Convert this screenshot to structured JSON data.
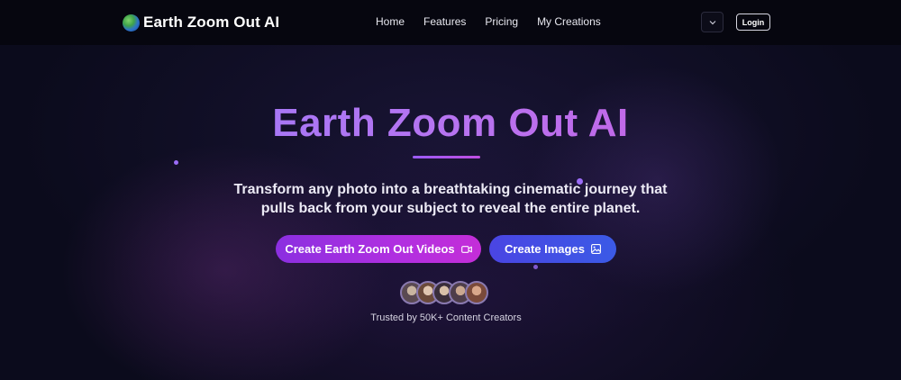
{
  "header": {
    "brand_name": "Earth Zoom Out AI",
    "brand_icon": "globe-icon",
    "nav": [
      "Home",
      "Features",
      "Pricing",
      "My Creations"
    ],
    "lang_icon": "chevron-down-icon",
    "login_label": "Login"
  },
  "hero": {
    "title": "Earth Zoom Out AI",
    "subtitle_line1": "Transform any photo into a breathtaking cinematic journey that",
    "subtitle_line2": "pulls back from your subject to reveal the entire planet.",
    "primary_button": {
      "label": "Create Earth Zoom Out Videos",
      "icon": "video-camera-icon"
    },
    "secondary_button": {
      "label": "Create Images",
      "icon": "image-icon"
    },
    "trusted_text": "Trusted by 50K+ Content Creators"
  },
  "colors": {
    "background": "#0b0b1c",
    "title_gradient": [
      "#a877f5",
      "#c069e8"
    ],
    "primary_button": "#b12fe0",
    "secondary_button": "#3b5ae6"
  }
}
